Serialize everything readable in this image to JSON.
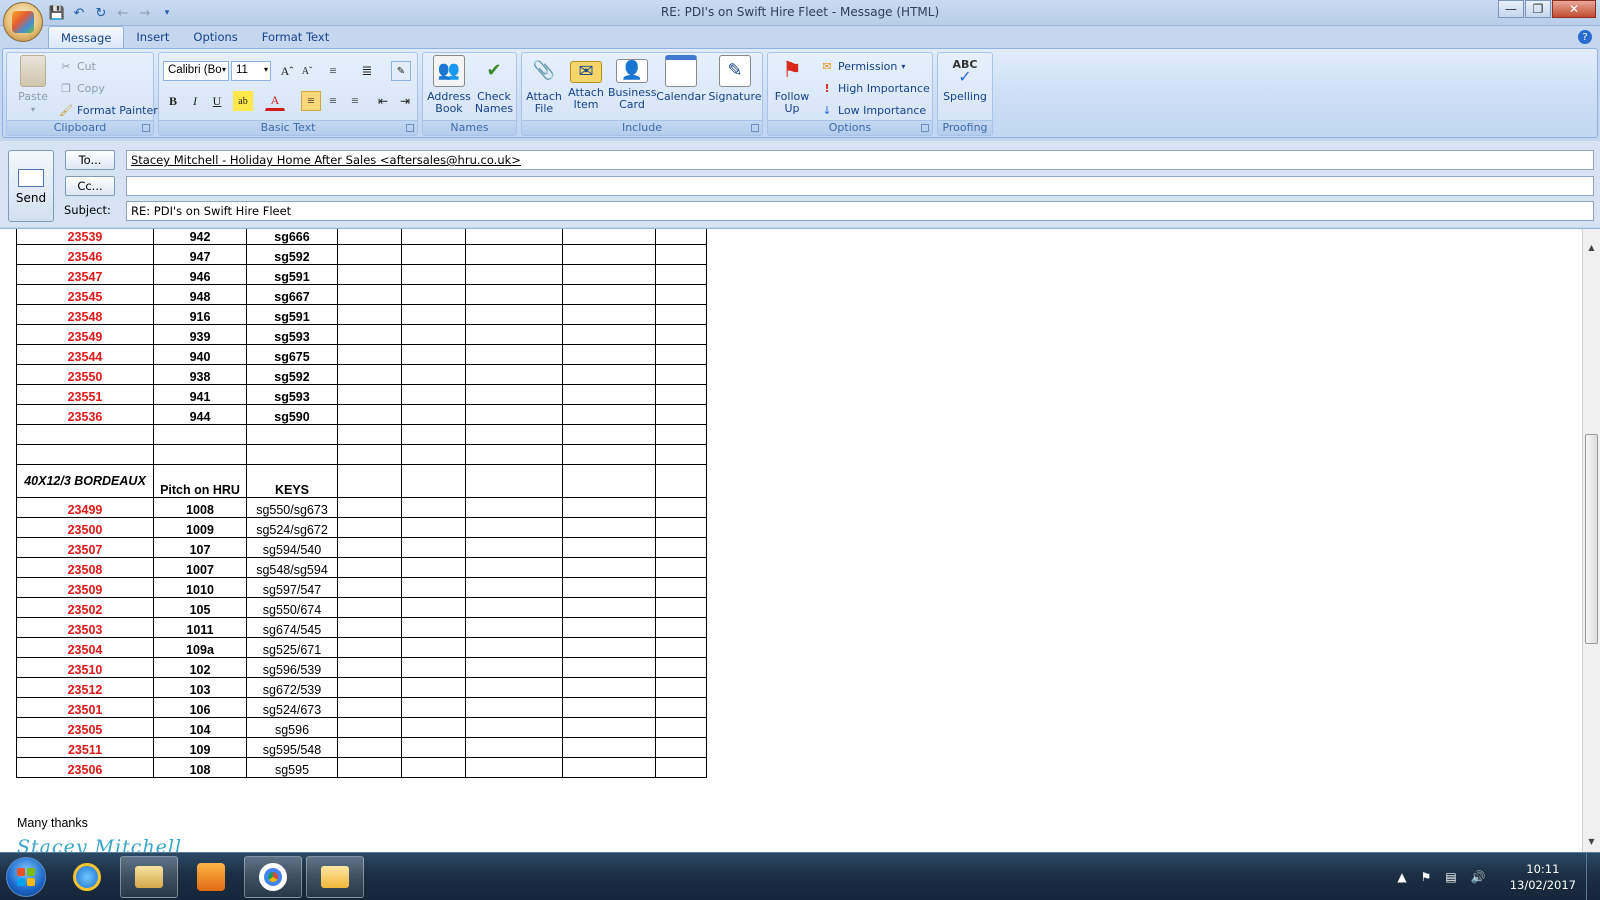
{
  "window": {
    "title": "RE: PDI's on Swift Hire Fleet - Message (HTML)"
  },
  "tabs": [
    "Message",
    "Insert",
    "Options",
    "Format Text"
  ],
  "ribbon": {
    "clipboard": {
      "label": "Clipboard",
      "paste": "Paste",
      "cut": "Cut",
      "copy": "Copy",
      "format_painter": "Format Painter"
    },
    "basic_text": {
      "label": "Basic Text",
      "font": "Calibri (Bo",
      "size": "11"
    },
    "names": {
      "label": "Names",
      "address_book": "Address Book",
      "check_names": "Check Names"
    },
    "include": {
      "label": "Include",
      "attach_file": "Attach File",
      "attach_item": "Attach Item",
      "business_card": "Business Card",
      "calendar": "Calendar",
      "signature": "Signature"
    },
    "options": {
      "label": "Options",
      "follow_up": "Follow Up",
      "permission": "Permission",
      "high_importance": "High Importance",
      "low_importance": "Low Importance"
    },
    "proofing": {
      "label": "Proofing",
      "spelling": "Spelling"
    }
  },
  "header": {
    "send": "Send",
    "to_button": "To...",
    "cc_button": "Cc...",
    "subject_label": "Subject:",
    "to_value": "Stacey Mitchell - Holiday Home After Sales <aftersales@hru.co.uk>",
    "cc_value": "",
    "subject_value": "RE: PDI's on Swift Hire Fleet"
  },
  "table": {
    "rows_top": [
      {
        "id": "23539",
        "pitch": "942",
        "keys": "sg666"
      },
      {
        "id": "23546",
        "pitch": "947",
        "keys": "sg592"
      },
      {
        "id": "23547",
        "pitch": "946",
        "keys": "sg591"
      },
      {
        "id": "23545",
        "pitch": "948",
        "keys": "sg667"
      },
      {
        "id": "23548",
        "pitch": "916",
        "keys": "sg591"
      },
      {
        "id": "23549",
        "pitch": "939",
        "keys": "sg593"
      },
      {
        "id": "23544",
        "pitch": "940",
        "keys": "sg675"
      },
      {
        "id": "23550",
        "pitch": "938",
        "keys": "sg592"
      },
      {
        "id": "23551",
        "pitch": "941",
        "keys": "sg593"
      },
      {
        "id": "23536",
        "pitch": "944",
        "keys": "sg590"
      }
    ],
    "section_header": {
      "model": "40X12/3 BORDEAUX",
      "pitch": "Pitch on HRU",
      "keys": "KEYS"
    },
    "rows_bottom": [
      {
        "id": "23499",
        "pitch": "1008",
        "keys": "sg550/sg673"
      },
      {
        "id": "23500",
        "pitch": "1009",
        "keys": "sg524/sg672"
      },
      {
        "id": "23507",
        "pitch": "107",
        "keys": "sg594/540"
      },
      {
        "id": "23508",
        "pitch": "1007",
        "keys": "sg548/sg594"
      },
      {
        "id": "23509",
        "pitch": "1010",
        "keys": "sg597/547"
      },
      {
        "id": "23502",
        "pitch": "105",
        "keys": "sg550/674"
      },
      {
        "id": "23503",
        "pitch": "1011",
        "keys": "sg674/545"
      },
      {
        "id": "23504",
        "pitch": "109a",
        "keys": "sg525/671"
      },
      {
        "id": "23510",
        "pitch": "102",
        "keys": "sg596/539"
      },
      {
        "id": "23512",
        "pitch": "103",
        "keys": "sg672/539"
      },
      {
        "id": "23501",
        "pitch": "106",
        "keys": "sg524/673"
      },
      {
        "id": "23505",
        "pitch": "104",
        "keys": "sg596"
      },
      {
        "id": "23511",
        "pitch": "109",
        "keys": "sg595/548"
      },
      {
        "id": "23506",
        "pitch": "108",
        "keys": "sg595"
      }
    ]
  },
  "body": {
    "closing": "Many thanks",
    "signature": "Stacey Mitchell"
  },
  "taskbar": {
    "time": "10:11",
    "date": "13/02/2017"
  },
  "colors": {
    "id_red": "#e01a1a",
    "ribbon_text": "#15428b",
    "signature": "#38a6c9"
  }
}
